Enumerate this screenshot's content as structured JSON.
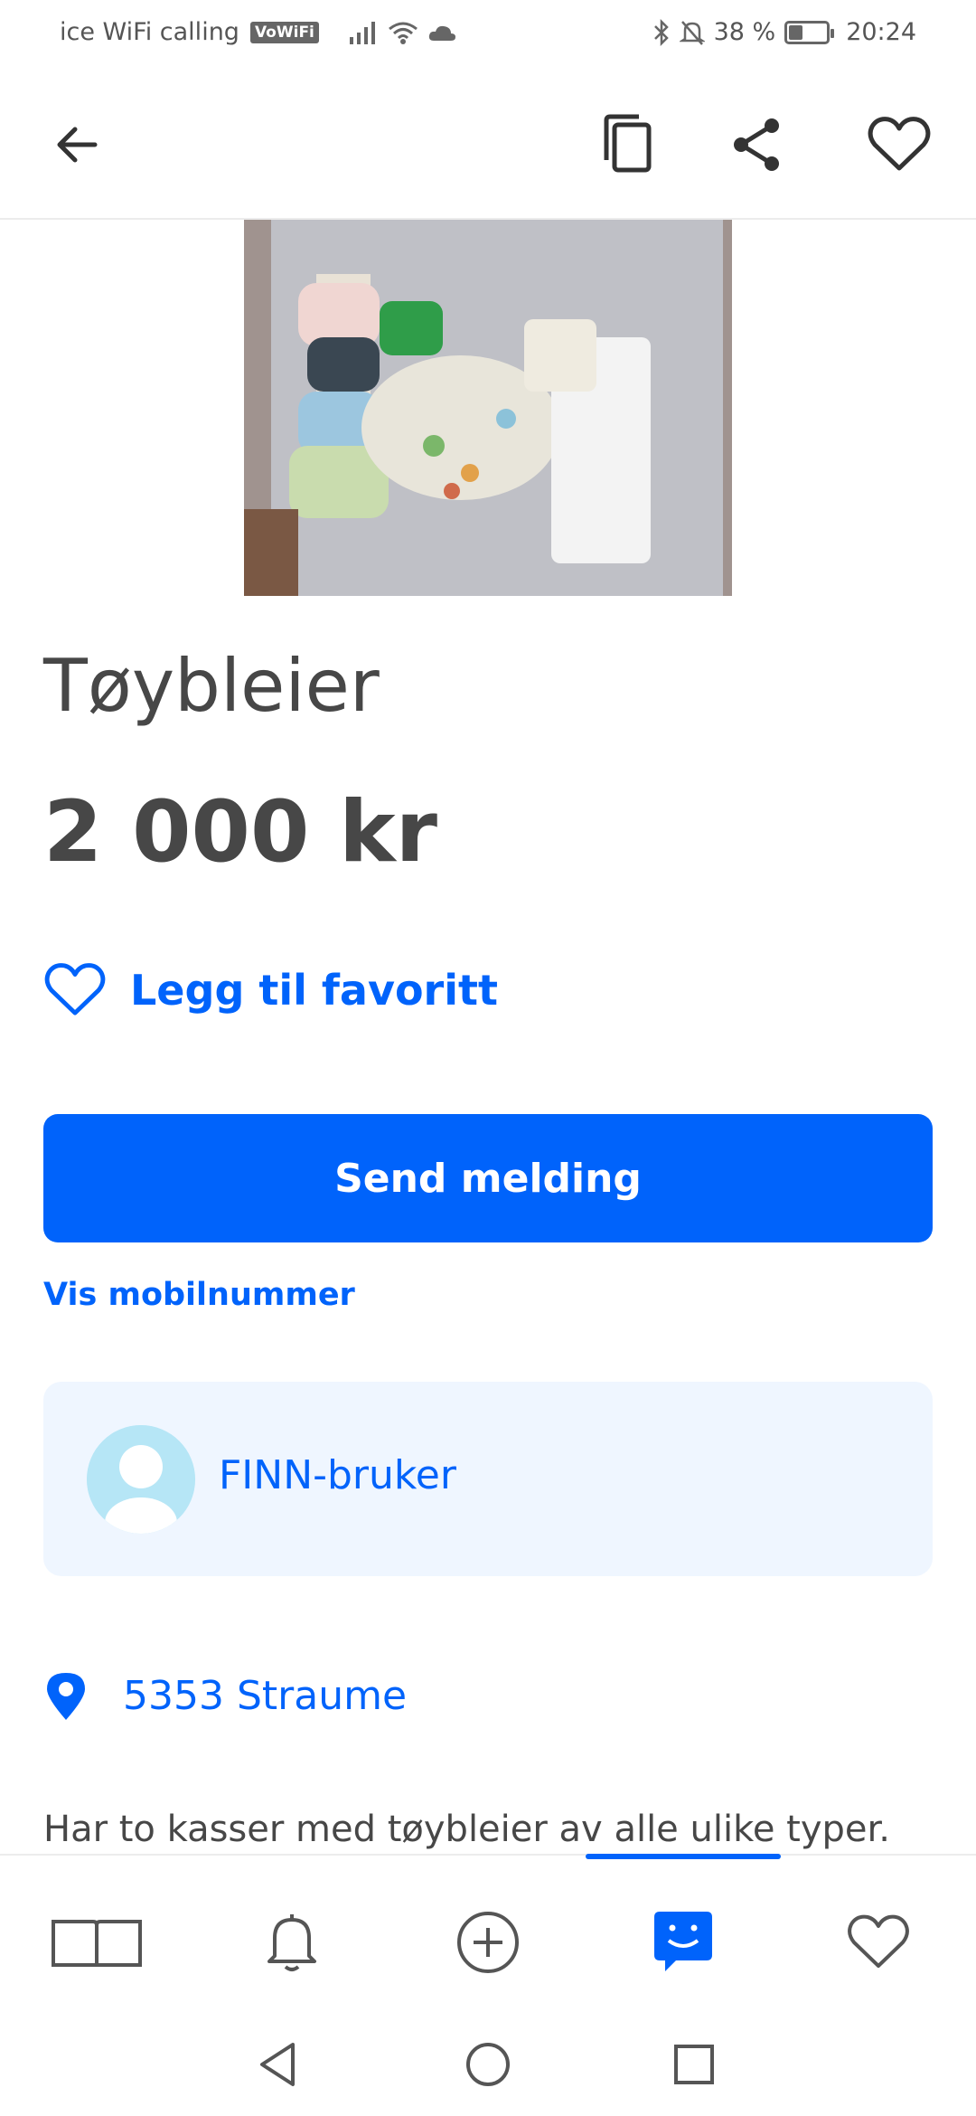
{
  "status_bar": {
    "carrier": "ice WiFi calling",
    "vowifi": "VoWiFi",
    "battery_percent": "38 %",
    "battery_level": 0.38,
    "time": "20:24"
  },
  "listing": {
    "title": "Tøybleier",
    "price": "2 000 kr",
    "favorite_label": "Legg til favoritt",
    "send_message_label": "Send melding",
    "show_phone_label": "Vis mobilnummer",
    "seller_name": "FINN-bruker",
    "location": "5353 Straume",
    "description_preview": "Har to kasser med tøybleier av alle ulike typer."
  },
  "icons": {
    "appbar": [
      "back-arrow-icon",
      "copy-icon",
      "share-icon",
      "heart-outline-icon"
    ],
    "bottom_nav": [
      "book-icon",
      "bell-icon",
      "add-circle-icon",
      "chat-icon",
      "heart-icon"
    ],
    "system_nav": [
      "back-triangle-icon",
      "home-circle-icon",
      "recents-square-icon"
    ]
  },
  "colors": {
    "accent": "#0063fb",
    "seller_bg": "#eff6ff",
    "text": "#474747",
    "icon_gray": "#555555"
  }
}
